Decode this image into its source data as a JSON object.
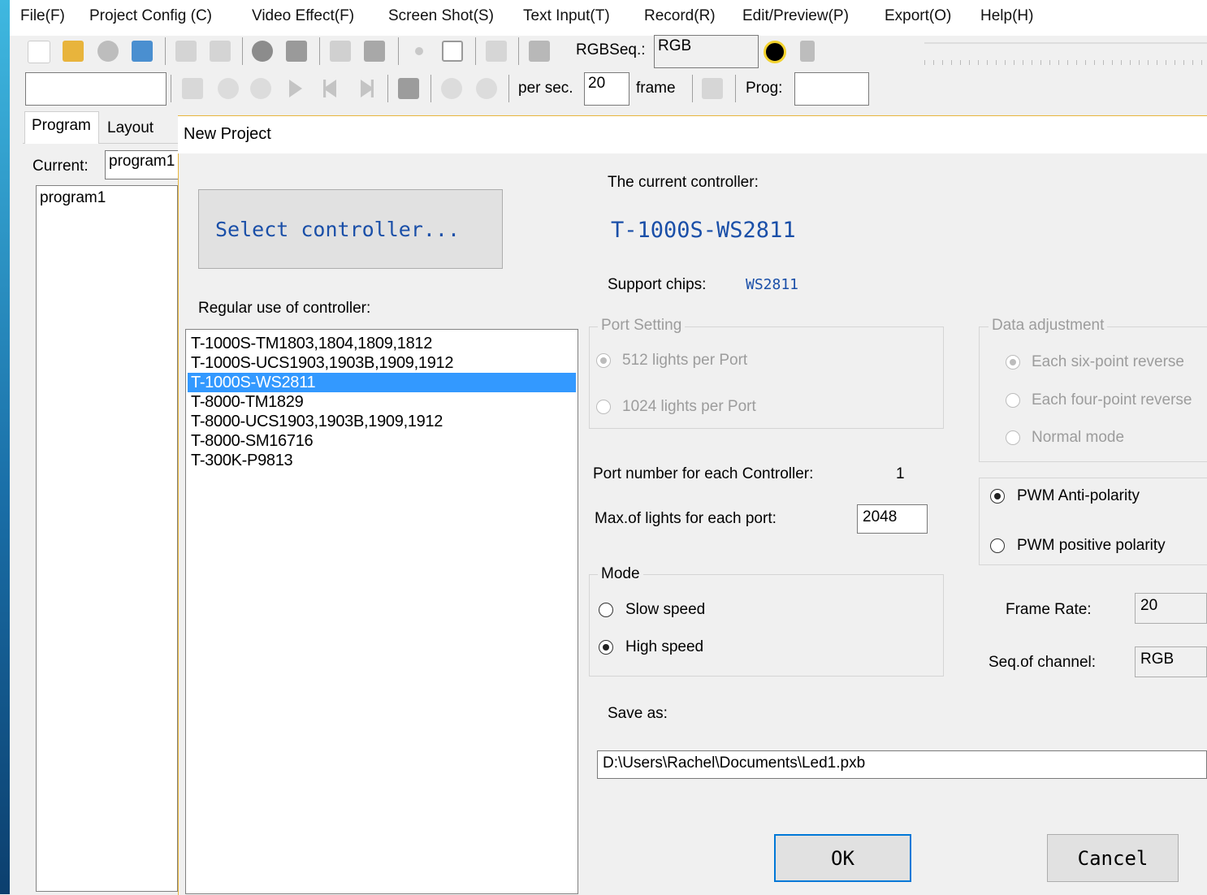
{
  "menu": [
    "File(F)",
    "Project Config (C)",
    "Video Effect(F)",
    "Screen Shot(S)",
    "Text Input(T)",
    "Record(R)",
    "Edit/Preview(P)",
    "Export(O)",
    "Help(H)"
  ],
  "toolbar": {
    "rgbseq_label": "RGBSeq.:",
    "rgbseq_value": "RGB",
    "per_sec_label": "per sec.",
    "per_sec_value": "20",
    "frame_label": "frame",
    "prog_label": "Prog:",
    "prog_value": ""
  },
  "left_panel": {
    "tabs": [
      "Program",
      "Layout"
    ],
    "current_label": "Current:",
    "current_value": "program1",
    "items": [
      "program1"
    ]
  },
  "dialog": {
    "title": "New Project",
    "select_button": "Select controller...",
    "regular_label": "Regular use of controller:",
    "controllers": [
      "T-1000S-TM1803,1804,1809,1812",
      "T-1000S-UCS1903,1903B,1909,1912",
      "T-1000S-WS2811",
      "T-8000-TM1829",
      "T-8000-UCS1903,1903B,1909,1912",
      "T-8000-SM16716",
      "T-300K-P9813"
    ],
    "selected_index": 2,
    "current_controller_label": "The current controller:",
    "current_controller": "T-1000S-WS2811",
    "support_chips_label": "Support chips:",
    "support_chips": "WS2811",
    "port_setting": {
      "title": "Port Setting",
      "options": [
        "512 lights per Port",
        "1024 lights per Port"
      ],
      "selected": 0,
      "disabled": true
    },
    "data_adjustment": {
      "title": "Data adjustment",
      "options": [
        "Each six-point reverse",
        "Each four-point reverse",
        "Normal mode"
      ],
      "selected": 0,
      "disabled": true
    },
    "pwm": {
      "options": [
        "PWM Anti-polarity",
        "PWM positive polarity"
      ],
      "selected": 0
    },
    "port_number_label": "Port number for each Controller:",
    "port_number": "1",
    "max_lights_label": "Max.of lights for each port:",
    "max_lights": "2048",
    "mode": {
      "title": "Mode",
      "options": [
        "Slow speed",
        "High speed"
      ],
      "selected": 1
    },
    "frame_rate_label": "Frame Rate:",
    "frame_rate": "20",
    "seq_channel_label": "Seq.of channel:",
    "seq_channel": "RGB",
    "save_as_label": "Save as:",
    "save_as_path": "D:\\Users\\Rachel\\Documents\\Led1.pxb",
    "ok_label": "OK",
    "cancel_label": "Cancel"
  },
  "colors": {
    "accent_blue": "#1a4fa8",
    "selection": "#3399ff",
    "dialog_border": "#e7b53c"
  }
}
